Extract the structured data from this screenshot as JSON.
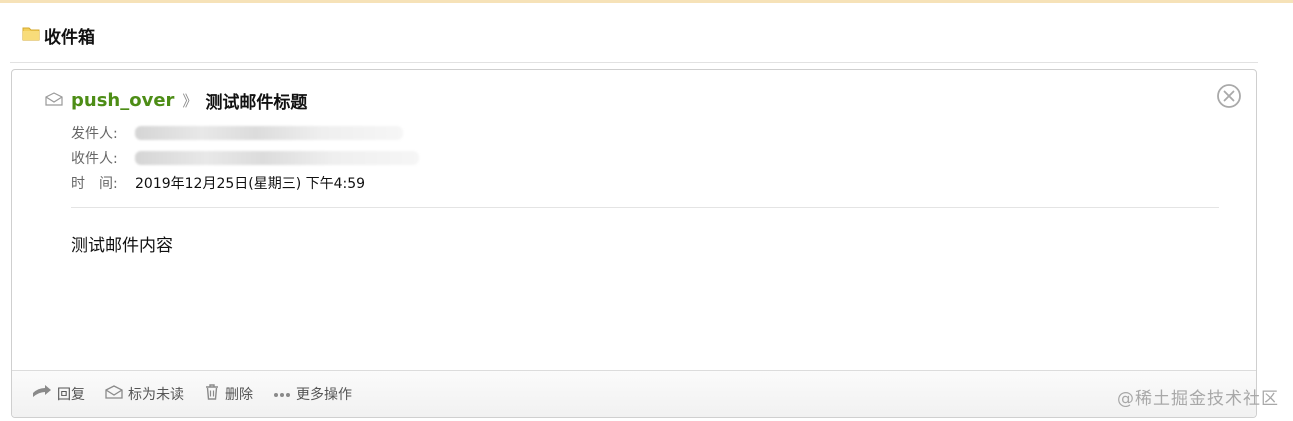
{
  "folder": {
    "title": "收件箱"
  },
  "mail": {
    "sender_name": "push_over",
    "separator": "》",
    "subject": "测试邮件标题",
    "from_label": "发件人:",
    "to_label": "收件人:",
    "time_label": "时　间:",
    "time_value": "2019年12月25日(星期三) 下午4:59",
    "body": "测试邮件内容"
  },
  "actions": {
    "reply": "回复",
    "mark_unread": "标为未读",
    "delete": "删除",
    "more": "更多操作"
  },
  "watermark": "@稀土掘金技术社区",
  "colors": {
    "sender": "#4d8d16",
    "top_border": "#f6e2b8"
  }
}
